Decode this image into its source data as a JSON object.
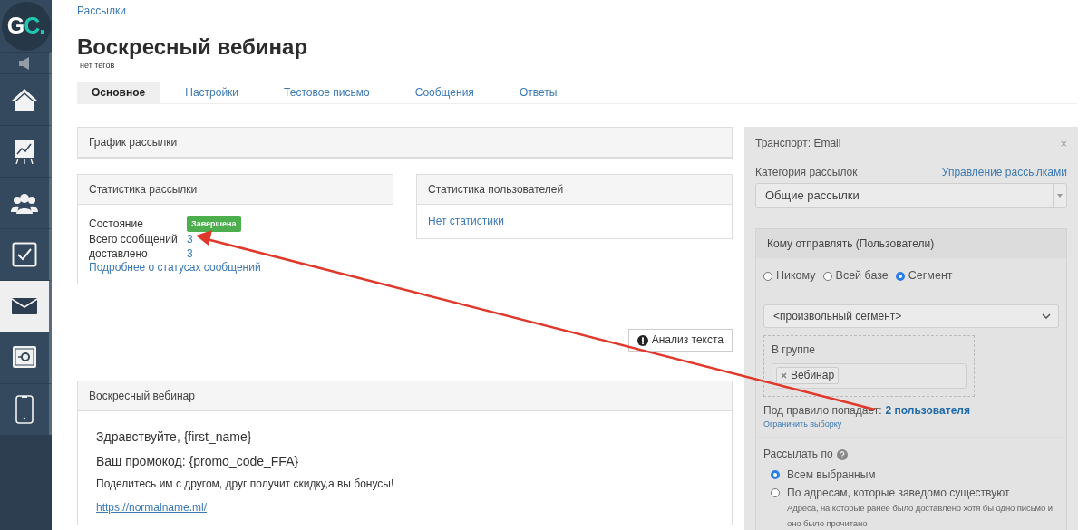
{
  "logo": {
    "parts": [
      {
        "text": "G",
        "color": "#ffffff"
      },
      {
        "text": "C.",
        "color": "#22c7b1"
      }
    ]
  },
  "sidebar": {
    "items": [
      {
        "kind": "megaphone",
        "selected": false
      },
      {
        "kind": "home",
        "selected": false
      },
      {
        "kind": "chart",
        "selected": false
      },
      {
        "kind": "users",
        "selected": false
      },
      {
        "kind": "tasks",
        "selected": false
      },
      {
        "kind": "mail",
        "selected": true
      },
      {
        "kind": "safe",
        "selected": false
      },
      {
        "kind": "phone",
        "selected": false
      }
    ]
  },
  "breadcrumb": "Рассылки",
  "title": "Воскресный вебинар",
  "tags": "нет тегов",
  "tabs": [
    {
      "label": "Основное",
      "selected": true
    },
    {
      "label": "Настройки",
      "selected": false
    },
    {
      "label": "Тестовое письмо",
      "selected": false
    },
    {
      "label": "Сообщения",
      "selected": false
    },
    {
      "label": "Ответы",
      "selected": false
    }
  ],
  "schedule_panel": {
    "title": "График рассылки"
  },
  "mailing_stats": {
    "title": "Статистика рассылки",
    "rows": [
      {
        "label": "Состояние",
        "value": "Завершена",
        "kind": "badge"
      },
      {
        "label": "Всего сообщений",
        "value": "3",
        "kind": "link"
      },
      {
        "label": "доставлено",
        "value": "3",
        "kind": "link"
      }
    ],
    "details_link": "Подробнее о статусах сообщений"
  },
  "user_stats": {
    "title": "Статистика пользователей",
    "empty_text": "Нет статистики"
  },
  "analyze_button": "Анализ текста",
  "letter": {
    "title": "Воскресный вебинар",
    "paragraphs": [
      {
        "kind": "large",
        "text": "Здравствуйте, {first_name}"
      },
      {
        "kind": "large",
        "text": "Ваш промокод: {promo_code_FFA}"
      },
      {
        "kind": "normal",
        "text": "Поделитесь им с другом, друг получит скидку,а  вы бонусы!"
      },
      {
        "kind": "link",
        "text": "https://normalname.ml/"
      }
    ]
  },
  "transport": {
    "title": "Транспорт: Email",
    "close": "×",
    "category_label": "Категория рассылок",
    "manage_link": "Управление рассылками",
    "category_value": "Общие рассылки",
    "recipients": {
      "title": "Кому отправлять (Пользователи)",
      "options": [
        {
          "label": "Никому",
          "selected": false
        },
        {
          "label": "Всей базе",
          "selected": false
        },
        {
          "label": "Сегмент",
          "selected": true
        }
      ],
      "segment_value": "<произвольный сегмент>",
      "group_label": "В группе",
      "group_tags": [
        {
          "label": "Вебинар"
        }
      ],
      "match_prefix": "Под правило попадает:",
      "match_count": "2 пользователя",
      "limit_link": "Ограничить выборку"
    },
    "send_by": {
      "label": "Рассылать по",
      "options": [
        {
          "label": "Всем выбранным",
          "selected": true
        },
        {
          "label": "По адресам, которые заведомо существуют",
          "selected": false,
          "hint": "Адреса, на которые ранее было доставлено хотя бы одно письмо и оно было прочитано"
        }
      ]
    }
  }
}
